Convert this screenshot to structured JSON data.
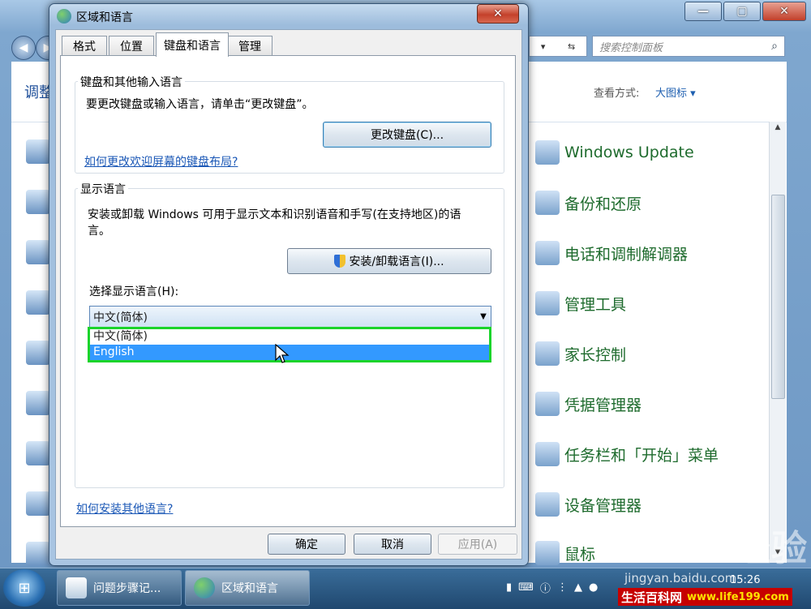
{
  "control_panel": {
    "left_title": "调整",
    "search_placeholder": "搜索控制面板",
    "view_label": "查看方式:",
    "view_value": "大图标 ▾",
    "items": [
      {
        "label": "Windows Update"
      },
      {
        "label": "备份和还原"
      },
      {
        "label": "电话和调制解调器"
      },
      {
        "label": "管理工具"
      },
      {
        "label": "家长控制"
      },
      {
        "label": "凭据管理器"
      },
      {
        "label": "任务栏和「开始」菜单"
      },
      {
        "label": "设备管理器"
      },
      {
        "label": "鼠标"
      }
    ]
  },
  "dialog": {
    "title": "区域和语言",
    "close_label": "✕",
    "tabs": [
      {
        "label": "格式"
      },
      {
        "label": "位置"
      },
      {
        "label": "键盘和语言",
        "active": true
      },
      {
        "label": "管理"
      }
    ],
    "keyboard_group": {
      "title": "键盘和其他输入语言",
      "description": "要更改键盘或输入语言，请单击“更改键盘”。",
      "button": "更改键盘(C)...",
      "link": "如何更改欢迎屏幕的键盘布局?"
    },
    "display_group": {
      "title": "显示语言",
      "description_line1": "安装或卸载 Windows 可用于显示文本和识别语音和手写(在支持地区)的语",
      "description_line2": "言。",
      "button": "安装/卸载语言(I)...",
      "select_label": "选择显示语言(H):",
      "select_value": "中文(简体)",
      "options": [
        {
          "label": "中文(简体)"
        },
        {
          "label": "English",
          "highlighted": true
        }
      ]
    },
    "bottom_link": "如何安装其他语言?",
    "buttons": {
      "ok": "确定",
      "cancel": "取消",
      "apply": "应用(A)"
    }
  },
  "taskbar": {
    "items": [
      {
        "label": "问题步骤记..."
      },
      {
        "label": "区域和语言",
        "active": true
      }
    ],
    "clock": "15:26"
  },
  "watermark": {
    "brand": "Baidu经验",
    "url": "jingyan.baidu.com",
    "site": "生活百科网",
    "site_url": "www.life199.com"
  },
  "colors": {
    "highlight_border": "#1bd42b",
    "selected_option": "#3399ff",
    "link": "#1a57b6",
    "cp_item_text": "#1e6b2d"
  }
}
